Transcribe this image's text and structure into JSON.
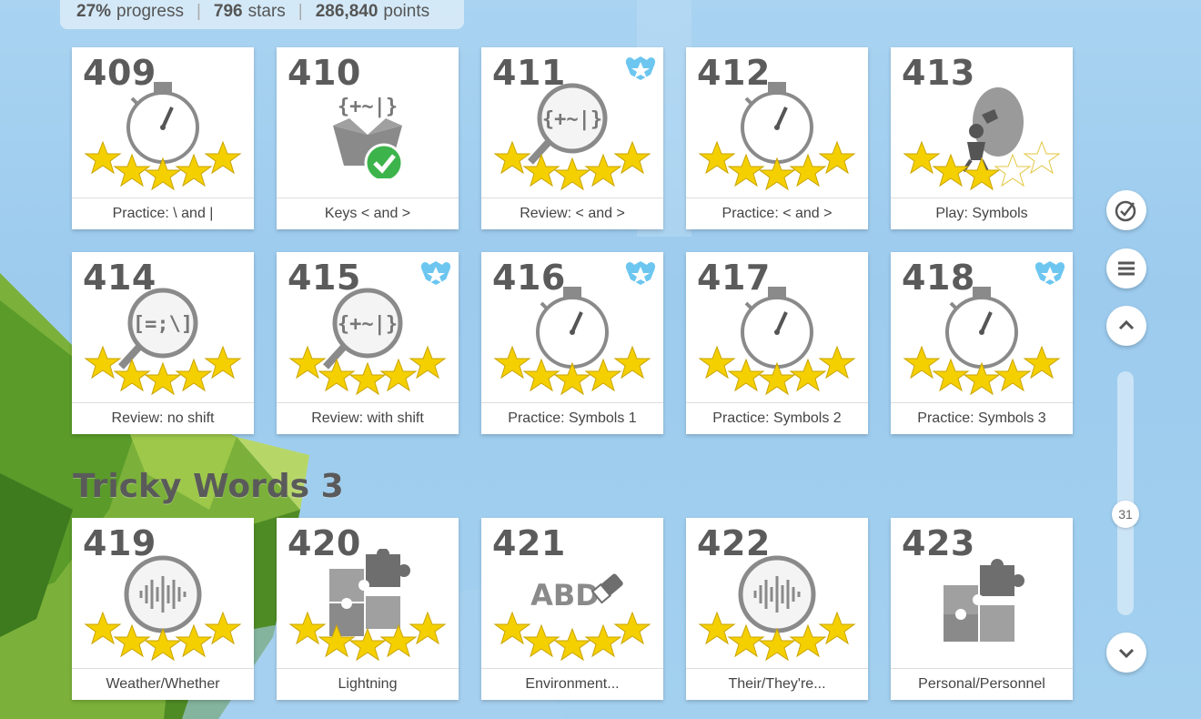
{
  "stats": {
    "progress_value": "27%",
    "progress_label": "progress",
    "stars_value": "796",
    "stars_label": "stars",
    "points_value": "286,840",
    "points_label": "points",
    "separator": "|"
  },
  "lessons_row1": [
    {
      "num": "409",
      "label": "Practice: \\ and |",
      "icon": "stopwatch-icon",
      "stars": 5,
      "badge": false
    },
    {
      "num": "410",
      "label": "Keys < and >",
      "icon": "symbol-box-check-icon",
      "stars": 0,
      "badge": false
    },
    {
      "num": "411",
      "label": "Review: < and >",
      "icon": "magnifier-symbols-icon",
      "stars": 5,
      "badge": true
    },
    {
      "num": "412",
      "label": "Practice: < and >",
      "icon": "stopwatch-icon",
      "stars": 5,
      "badge": false
    },
    {
      "num": "413",
      "label": "Play: Symbols",
      "icon": "balloon-game-icon",
      "stars": 3,
      "badge": false
    }
  ],
  "lessons_row2": [
    {
      "num": "414",
      "label": "Review: no shift",
      "icon": "magnifier-noshift-icon",
      "stars": 5,
      "badge": false
    },
    {
      "num": "415",
      "label": "Review: with shift",
      "icon": "magnifier-symbols-icon",
      "stars": 5,
      "badge": true
    },
    {
      "num": "416",
      "label": "Practice: Symbols 1",
      "icon": "stopwatch-icon",
      "stars": 5,
      "badge": true
    },
    {
      "num": "417",
      "label": "Practice: Symbols 2",
      "icon": "stopwatch-icon",
      "stars": 5,
      "badge": false
    },
    {
      "num": "418",
      "label": "Practice: Symbols 3",
      "icon": "stopwatch-icon",
      "stars": 5,
      "badge": true
    }
  ],
  "section": {
    "title": "Tricky Words 3"
  },
  "lessons_row3": [
    {
      "num": "419",
      "label": "Weather/Whether",
      "icon": "audio-wave-icon",
      "stars": 5,
      "badge": false
    },
    {
      "num": "420",
      "label": "Lightning",
      "icon": "puzzle-icon",
      "stars": 5,
      "badge": false
    },
    {
      "num": "421",
      "label": "Environment...",
      "icon": "abc-eraser-icon",
      "stars": 5,
      "badge": false
    },
    {
      "num": "422",
      "label": "Their/They're...",
      "icon": "audio-wave-icon",
      "stars": 5,
      "badge": false
    },
    {
      "num": "423",
      "label": "Personal/Personnel",
      "icon": "puzzle-icon",
      "stars": 0,
      "badge": false
    }
  ],
  "icon_text": {
    "symbols": "{+~|}",
    "noshift": "[=;\\]",
    "abc": "ABD"
  },
  "controls": {
    "scroll_page": "31"
  },
  "colors": {
    "star": "#f5d000",
    "icon_gray": "#8a8a8a",
    "check_green": "#3cb44b",
    "badge_blue": "#6cc6f0"
  }
}
